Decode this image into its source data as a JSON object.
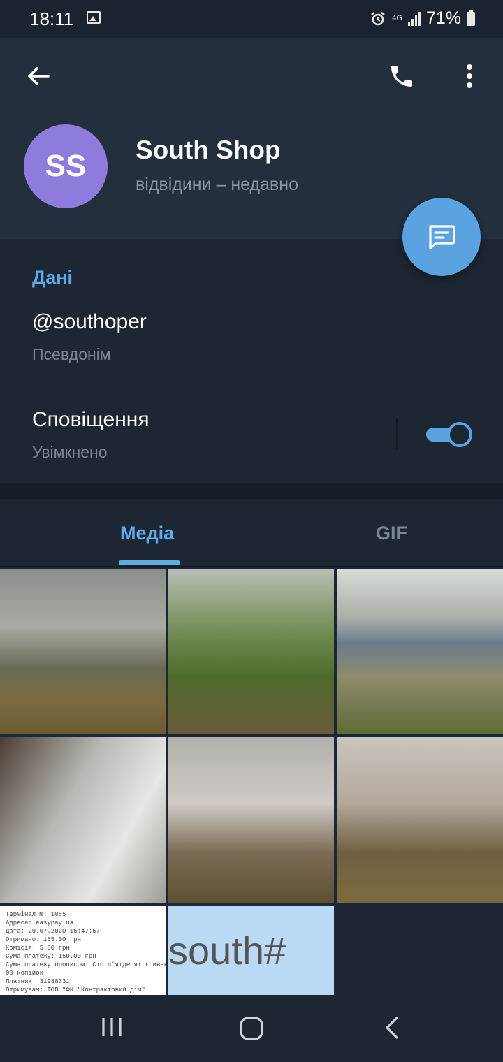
{
  "status_bar": {
    "time": "18:11",
    "network": "4G",
    "battery": "71%",
    "icons": [
      "image-icon",
      "alarm-icon",
      "signal-icon",
      "battery-icon"
    ]
  },
  "header": {
    "avatar_initials": "SS",
    "name": "South Shop",
    "status": "відвідини – недавно",
    "accent": "#5aa3e0",
    "avatar_color": "#8e7bdc"
  },
  "info": {
    "section_title": "Дані",
    "username": "@southoper",
    "username_label": "Псевдонім",
    "notifications_title": "Сповіщення",
    "notifications_value": "Увімкнено",
    "notifications_enabled": true
  },
  "tabs": {
    "media": "Медіа",
    "gif": "GIF",
    "active": "media"
  },
  "media": {
    "receipt_lines": [
      "Термінал №: 1055",
      "Адреса: easypay.ua",
      "Дата: 29.07.2020 15:47:57",
      "Отримано: 155.00 грн",
      "Комісія: 5.00 грн",
      "Сума платежу: 150.00 грн",
      "Сума платежу прописом: Сто п'ятдесят гривень",
      "00 копійок",
      "Платник: 31988331",
      "Отримувач: ТОВ \"ФК \"Контрактовий дім\""
    ],
    "text_tile": "south#"
  }
}
